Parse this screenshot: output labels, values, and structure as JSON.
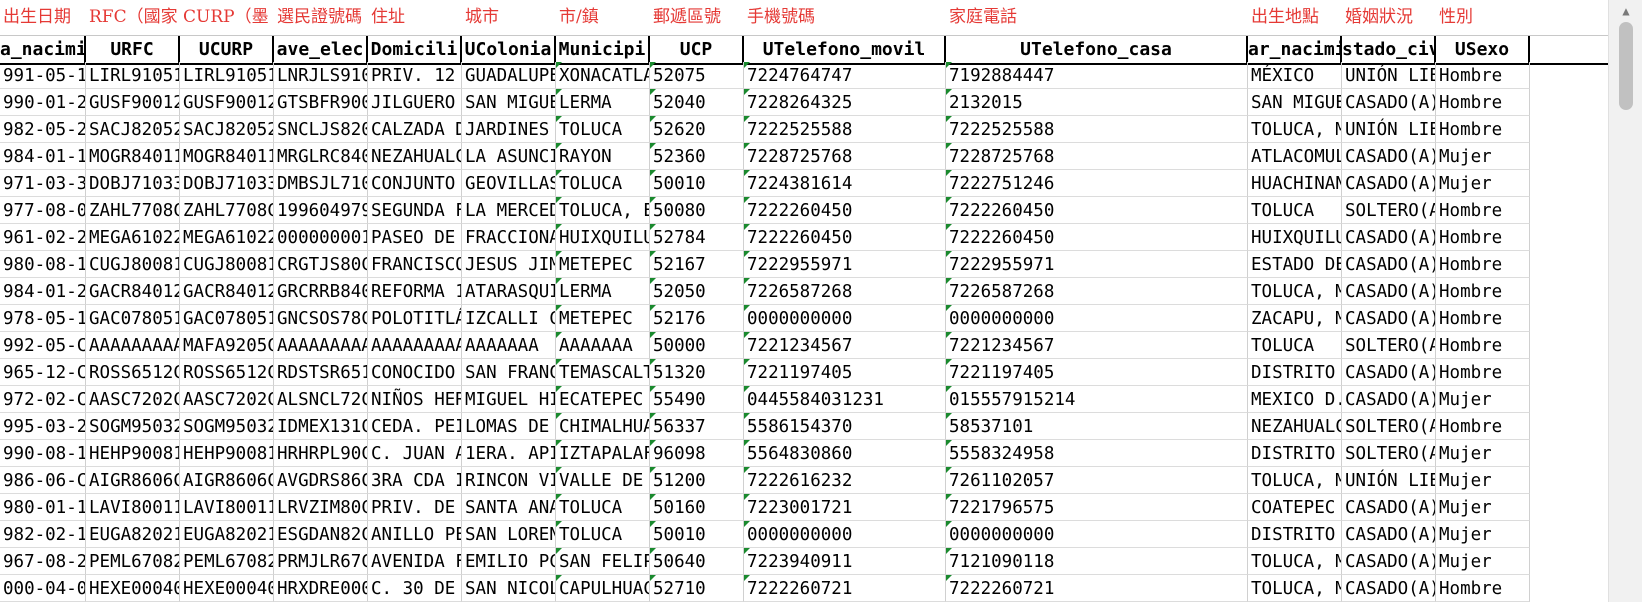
{
  "sheet": {
    "labels": [
      "出生日期",
      "RFC（國家",
      "CURP（墨",
      "選民證號碼",
      "住址",
      "城市",
      "市/鎮",
      "郵遞區號",
      "手機號碼",
      "家庭電話",
      "",
      "出生地點",
      "婚姻狀況",
      "性別"
    ],
    "headers": [
      "a_nacimi",
      "URFC",
      "UCURP",
      "ave_elec",
      "Domicili",
      "UColonia",
      "Municipi",
      "UCP",
      "UTelefono_movil",
      "UTelefono_casa",
      "",
      "ar_nacimi",
      "stado_civ",
      "USexo"
    ],
    "rows": [
      [
        "991-05-1",
        "LIRL91051",
        "LIRL91051",
        "LNRJLS910",
        "PRIV. 12",
        "GUADALUPE",
        "XONACATLA",
        "52075",
        "7224764747",
        "7192884447",
        "",
        "MÉXICO",
        "UNIÓN LIE",
        "Hombre"
      ],
      [
        "990-01-2",
        "GUSF90012",
        "GUSF90012",
        "GTSBFR900",
        "JILGUERO",
        "SAN MIGUE",
        "LERMA",
        "52040",
        "7228264325",
        "2132015",
        "",
        "SAN MIGUE",
        "CASADO(A)",
        "Hombre"
      ],
      [
        "982-05-2",
        "SACJ82052",
        "SACJ82052",
        "SNCLJS820",
        "CALZADA D",
        "JARDINES",
        "TOLUCA",
        "52620",
        "7222525588",
        "7222525588",
        "",
        "TOLUCA, M",
        "UNIÓN LIE",
        "Hombre"
      ],
      [
        "984-01-1",
        "MOGR84011",
        "MOGR84011",
        "MRGLRC840",
        "NEZAHUALC",
        "LA ASUNCI",
        "RAYON",
        "52360",
        "7228725768",
        "7228725768",
        "",
        "ATLACOMUL",
        "CASADO(A)",
        "Mujer"
      ],
      [
        "971-03-3",
        "DOBJ71033",
        "DOBJ71033",
        "DMBSJL710",
        "CONJUNTO",
        "GEOVILLAS",
        "TOLUCA",
        "50010",
        "7224381614",
        "7222751246",
        "",
        "HUACHINAN",
        "CASADO(A)",
        "Mujer"
      ],
      [
        "977-08-0",
        "ZAHL7708C",
        "ZAHL7708C",
        "199604979",
        "SEGUNDA F",
        "LA MERCED",
        "TOLUCA, E",
        "50080",
        "7222260450",
        "7222260450",
        "",
        "TOLUCA",
        "SOLTERO(A",
        "Hombre"
      ],
      [
        "961-02-2",
        "MEGA61022",
        "MEGA61022",
        "000000001",
        "PASEO DE",
        "FRACCIONA",
        "HUIXQUILU",
        "52784",
        "7222260450",
        "7222260450",
        "",
        "HUIXQUILU",
        "CASADO(A)",
        "Hombre"
      ],
      [
        "980-08-1",
        "CUGJ80081",
        "CUGJ80081",
        "CRGTJS80C",
        "FRANCISCO",
        "JESUS JIM",
        "METEPEC",
        "52167",
        "7222955971",
        "7222955971",
        "",
        "ESTADO DE",
        "CASADO(A)",
        "Hombre"
      ],
      [
        "984-01-2",
        "GACR84012",
        "GACR84012",
        "GRCRRB840",
        "REFORMA 1",
        "ATARASQUI",
        "LERMA",
        "52050",
        "7226587268",
        "7226587268",
        "",
        "TOLUCA, M",
        "CASADO(A)",
        "Hombre"
      ],
      [
        "978-05-1",
        "GAC078051",
        "GAC078051",
        "GNCSOS78C",
        "POLOTITLÁ",
        "IZCALLI C",
        "METEPEC",
        "52176",
        "0000000000",
        "0000000000",
        "",
        "ZACAPU, M",
        "CASADO(A)",
        "Hombre"
      ],
      [
        "992-05-C",
        "AAAAAAAAA",
        "MAFA9205C",
        "AAAAAAAAA",
        "AAAAAAAAA",
        "AAAAAAA",
        "AAAAAAA",
        "50000",
        "7221234567",
        "7221234567",
        "",
        "TOLUCA",
        "SOLTERO(A",
        "Hombre"
      ],
      [
        "965-12-C",
        "ROSS6512C",
        "ROSS6512C",
        "RDSTSR651",
        "CONOCIDO",
        "SAN FRANC",
        "TEMASCALT",
        "51320",
        "7221197405",
        "7221197405",
        "",
        "DISTRITO",
        "CASADO(A)",
        "Hombre"
      ],
      [
        "972-02-C",
        "AASC7202C",
        "AASC7202C",
        "ALSNCL72C",
        "NIÑOS HER",
        "MIGUEL HI",
        "ECATEPEC",
        "55490",
        "0445584031231",
        "015557915214",
        "",
        "MEXICO D.",
        "CASADO(A)",
        "Mujer"
      ],
      [
        "995-03-2",
        "SOGM95032",
        "SOGM95032",
        "IDMEX131C",
        "CEDA. PEI",
        "LOMAS DE",
        "CHIMALHUA",
        "56337",
        "5586154370",
        "58537101",
        "",
        "NEZAHUALC",
        "SOLTERO(A",
        "Hombre"
      ],
      [
        "990-08-1",
        "HEHP90081",
        "HEHP90081",
        "HRHRPL90C",
        "C. JUAN A",
        "1ERA. API",
        "IZTAPALAF",
        "96098",
        "5564830860",
        "5558324958",
        "",
        "DISTRITO",
        "SOLTERO(A",
        "Mujer"
      ],
      [
        "986-06-C",
        "AIGR8606C",
        "AIGR8606C",
        "AVGDRS86C",
        "3RA CDA I",
        "RINCON VI",
        "VALLE DE",
        "51200",
        "7222616232",
        "7261102057",
        "",
        "TOLUCA, M",
        "UNIÓN LIE",
        "Mujer"
      ],
      [
        "980-01-1",
        "LAVI80011",
        "LAVI80011",
        "LRVZIM80C",
        "PRIV. DE",
        "SANTA ANA",
        "TOLUCA",
        "50160",
        "7223001721",
        "7221796575",
        "",
        "COATEPEC",
        "CASADO(A)",
        "Mujer"
      ],
      [
        "982-02-1",
        "EUGA82021",
        "EUGA82021",
        "ESGDAN82C",
        "ANILLO PE",
        "SAN LOREN",
        "TOLUCA",
        "50010",
        "0000000000",
        "0000000000",
        "",
        "DISTRITO",
        "CASADO(A)",
        "Mujer"
      ],
      [
        "967-08-2",
        "PEML67082",
        "PEML67082",
        "PRMJLR67C",
        "AVENIDA F",
        "EMILIO PC",
        "SAN FELIP",
        "50640",
        "7223940911",
        "7121090118",
        "",
        "TOLUCA, M",
        "CASADO(A)",
        "Mujer"
      ],
      [
        "000-04-0",
        "HEXE00040",
        "HEXE00040",
        "HRXDRE000",
        "C. 30 DE",
        "SAN NICOL",
        "CAPULHUAC",
        "52710",
        "7222260721",
        "7222260721",
        "",
        "TOLUCA, M",
        "CASADO(A)",
        "Hombre"
      ]
    ]
  }
}
